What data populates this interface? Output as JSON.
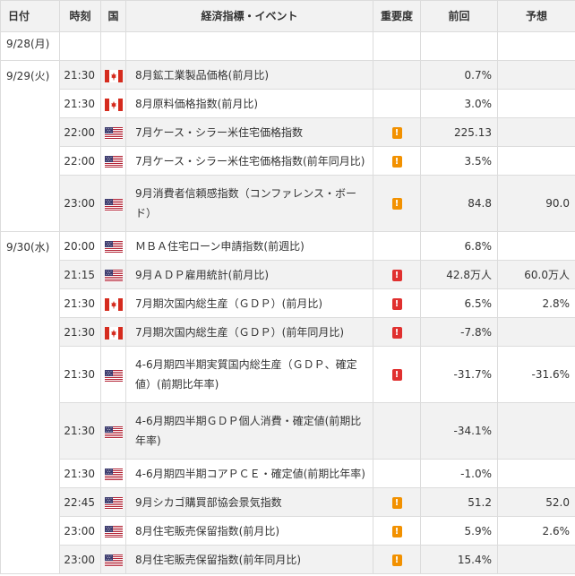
{
  "headers": {
    "date": "日付",
    "time": "時刻",
    "country": "国",
    "event": "経済指標・イベント",
    "importance": "重要度",
    "previous": "前回",
    "forecast": "予想"
  },
  "colors": {
    "importance_mid": "#f29100",
    "importance_high": "#e0302f",
    "row_alt": "#f2f2f2",
    "border": "#dcdcdc"
  },
  "rows": [
    {
      "date": "9/28(月)",
      "time": "",
      "country": "",
      "event": "",
      "importance": "",
      "previous": "",
      "forecast": ""
    },
    {
      "date": "9/29(火)",
      "time": "21:30",
      "country": "canada-flag",
      "event": "8月鉱工業製品価格(前月比)",
      "importance": "",
      "previous": "0.7%",
      "forecast": ""
    },
    {
      "date": "",
      "time": "21:30",
      "country": "canada-flag",
      "event": "8月原料価格指数(前月比)",
      "importance": "",
      "previous": "3.0%",
      "forecast": ""
    },
    {
      "date": "",
      "time": "22:00",
      "country": "us-flag",
      "event": "7月ケース・シラー米住宅価格指数",
      "importance": "!",
      "previous": "225.13",
      "forecast": ""
    },
    {
      "date": "",
      "time": "22:00",
      "country": "us-flag",
      "event": "7月ケース・シラー米住宅価格指数(前年同月比)",
      "importance": "!",
      "previous": "3.5%",
      "forecast": ""
    },
    {
      "date": "",
      "time": "23:00",
      "country": "us-flag",
      "event": "9月消費者信頼感指数（コンファレンス・ボード）",
      "importance": "!",
      "previous": "84.8",
      "forecast": "90.0"
    },
    {
      "date": "9/30(水)",
      "time": "20:00",
      "country": "us-flag",
      "event": "ＭＢＡ住宅ローン申請指数(前週比)",
      "importance": "",
      "previous": "6.8%",
      "forecast": ""
    },
    {
      "date": "",
      "time": "21:15",
      "country": "us-flag",
      "event": "9月ＡＤＰ雇用統計(前月比)",
      "importance": "!",
      "previous": "42.8万人",
      "forecast": "60.0万人"
    },
    {
      "date": "",
      "time": "21:30",
      "country": "canada-flag",
      "event": "7月期次国内総生産（ＧＤＰ）(前月比)",
      "importance": "!",
      "previous": "6.5%",
      "forecast": "2.8%"
    },
    {
      "date": "",
      "time": "21:30",
      "country": "canada-flag",
      "event": "7月期次国内総生産（ＧＤＰ）(前年同月比)",
      "importance": "!",
      "previous": "-7.8%",
      "forecast": ""
    },
    {
      "date": "",
      "time": "21:30",
      "country": "us-flag",
      "event": "4-6月期四半期実質国内総生産（ＧＤＰ、確定値）(前期比年率)",
      "importance": "!",
      "previous": "-31.7%",
      "forecast": "-31.6%"
    },
    {
      "date": "",
      "time": "21:30",
      "country": "us-flag",
      "event": "4-6月期四半期ＧＤＰ個人消費・確定値(前期比年率)",
      "importance": "",
      "previous": "-34.1%",
      "forecast": ""
    },
    {
      "date": "",
      "time": "21:30",
      "country": "us-flag",
      "event": "4-6月期四半期コアＰＣＥ・確定値(前期比年率)",
      "importance": "",
      "previous": "-1.0%",
      "forecast": ""
    },
    {
      "date": "",
      "time": "22:45",
      "country": "us-flag",
      "event": "9月シカゴ購買部協会景気指数",
      "importance": "!",
      "previous": "51.2",
      "forecast": "52.0"
    },
    {
      "date": "",
      "time": "23:00",
      "country": "us-flag",
      "event": "8月住宅販売保留指数(前月比)",
      "importance": "!",
      "previous": "5.9%",
      "forecast": "2.6%"
    },
    {
      "date": "",
      "time": "23:00",
      "country": "us-flag",
      "event": "8月住宅販売保留指数(前年同月比)",
      "importance": "!",
      "previous": "15.4%",
      "forecast": ""
    }
  ]
}
